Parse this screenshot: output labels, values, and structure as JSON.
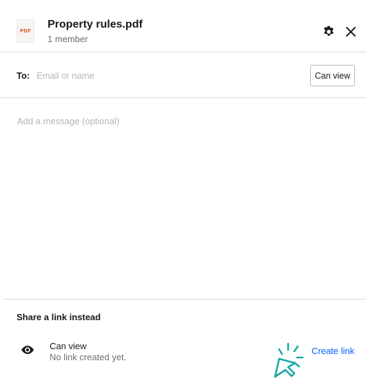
{
  "header": {
    "file_type_label": "PDF",
    "file_name": "Property rules.pdf",
    "member_count": "1 member",
    "settings_icon": "gear-icon",
    "close_icon": "close-icon"
  },
  "to_row": {
    "label": "To:",
    "placeholder": "Email or name",
    "value": "",
    "permission": "Can view"
  },
  "message": {
    "placeholder": "Add a message (optional)",
    "value": ""
  },
  "share_link": {
    "heading": "Share a link instead",
    "icon": "eye-icon",
    "permission": "Can view",
    "status": "No link created yet.",
    "create_label": "Create link",
    "cursor_icon": "click-cursor-icon"
  },
  "colors": {
    "text_primary": "#1e1919",
    "text_secondary": "#736c64",
    "placeholder": "#bbb5ae",
    "divider": "#dcdad7",
    "link_blue": "#0061fe",
    "cursor_teal": "#17a9a6",
    "pdf_orange": "#e8572a"
  }
}
